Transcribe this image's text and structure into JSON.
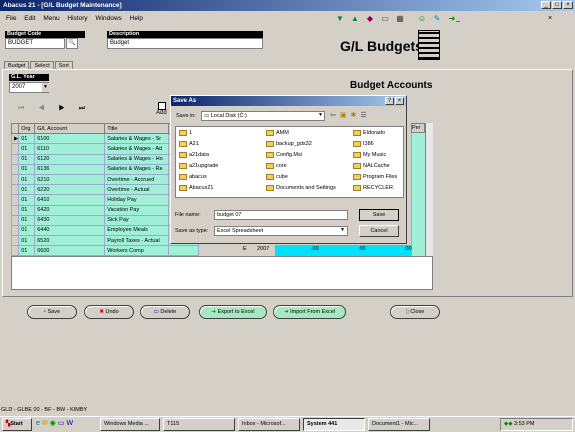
{
  "window": {
    "title": "Abacus 21 - [G/L Budget Maintenance]"
  },
  "menu": [
    "File",
    "Edit",
    "Menu",
    "History",
    "Windows",
    "Help"
  ],
  "header": {
    "budget_code_label": "Budget Code",
    "budget_code_value": "BUDGET",
    "description_label": "Description",
    "description_value": "Budget",
    "app_title": "G/L Budgets"
  },
  "tabs": [
    "Budget",
    "Select",
    "Sort"
  ],
  "gl_year": {
    "label": "G.L. Year",
    "value": "2007"
  },
  "section_title": "Budget Accounts",
  "add_label": "Add",
  "grid": {
    "headers": [
      "Org",
      "G/L Account",
      "Title",
      "Per"
    ],
    "rows": [
      {
        "org": "01",
        "account": "6100",
        "title": "Salaries & Wages - Sr"
      },
      {
        "org": "01",
        "account": "6110",
        "title": "Salaries & Wages - Ad"
      },
      {
        "org": "01",
        "account": "6120",
        "title": "Salaries & Wages - Ho"
      },
      {
        "org": "01",
        "account": "6136",
        "title": "Salaries & Wages - Re"
      },
      {
        "org": "01",
        "account": "6210",
        "title": "Overtime - Accrued"
      },
      {
        "org": "01",
        "account": "6220",
        "title": "Overtime - Actual"
      },
      {
        "org": "01",
        "account": "6410",
        "title": "Holiday Pay"
      },
      {
        "org": "01",
        "account": "6420",
        "title": "Vacation Pay"
      },
      {
        "org": "01",
        "account": "6430",
        "title": "Sick Pay"
      },
      {
        "org": "01",
        "account": "6440",
        "title": "Employee Meals"
      },
      {
        "org": "01",
        "account": "6520",
        "title": "Payroll Taxes - Actual"
      },
      {
        "org": "01",
        "account": "6600",
        "title": "Workers Comp"
      }
    ],
    "last_row_extra": {
      "type": "E",
      "year": "2007",
      "amt1": ".00",
      "amt2": ".00",
      "amt3": ".00"
    }
  },
  "buttons": {
    "save": "Save",
    "undo": "Undo",
    "delete": "Delete",
    "export": "Export to Excel",
    "import": "Import From Excel",
    "close": "Close"
  },
  "dialog": {
    "title": "Save As",
    "save_in_label": "Save in:",
    "save_in_value": "Local Disk (C:)",
    "items": [
      "1",
      "A21",
      "a21data",
      "a21upgrade",
      "abacus",
      "Abacus21",
      "AMM",
      "backup_gds32",
      "Config.Msi",
      "core",
      "cube",
      "Documents and Settings",
      "Eldorado",
      "I386",
      "My Music",
      "NALCache",
      "Program Files",
      "RECYCLER"
    ],
    "file_name_label": "File name:",
    "file_name_value": "budget 07",
    "save_type_label": "Save as type:",
    "save_type_value": "Excel Spreadsheet",
    "save_button": "Save",
    "cancel_button": "Cancel"
  },
  "status_bar": {
    "text": "GLD - GLBE          00 - BF - BW - KIMBY"
  },
  "taskbar": {
    "start": "Start",
    "items": [
      "Windows Media ...",
      "T115",
      "Inbox - Microsof...",
      "System 441",
      "Document1 - Mic..."
    ],
    "clock": "3:53 PM"
  }
}
